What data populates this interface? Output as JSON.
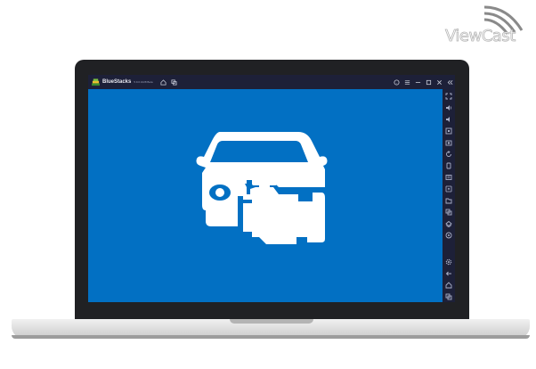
{
  "brand": {
    "logo_text": "ViewCast"
  },
  "window": {
    "app_name": "BlueStacks",
    "version_text": "5.9.0.1028 Beta",
    "controls": [
      "help-icon",
      "menu-icon",
      "minimize-icon",
      "maximize-icon",
      "close-icon",
      "collapse-sidebar-icon"
    ]
  },
  "sidebar": {
    "icons_top": [
      "fullscreen-icon",
      "volume-up-icon",
      "volume-down-icon",
      "keymapping-icon",
      "screenshot-icon",
      "rotate-icon",
      "shake-icon",
      "macro-icon",
      "multi-instance-icon",
      "folder-icon",
      "copy-icon",
      "eco-mode-icon",
      "location-icon"
    ],
    "icons_bottom": [
      "settings-icon",
      "back-icon",
      "home-icon",
      "recent-apps-icon"
    ]
  },
  "app_screen": {
    "background": "#0270c3",
    "icon": "car-engine-icon"
  },
  "colors": {
    "chrome": "#1d2038",
    "bezel": "#202124",
    "accent": "#0270c3"
  }
}
